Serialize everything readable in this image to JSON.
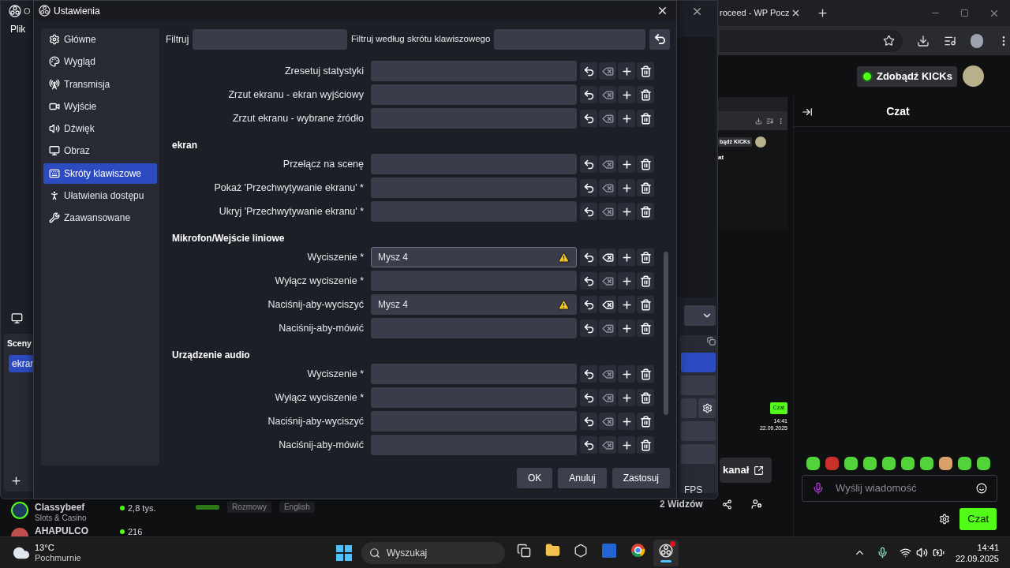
{
  "obs_main": {
    "title": "O",
    "menu": [
      "Plik"
    ],
    "scenes_title": "Sceny",
    "scenes": [
      {
        "label": "ekran",
        "selected": true
      }
    ],
    "status": "FPS"
  },
  "dialog": {
    "title": "Ustawienia",
    "sidebar": [
      {
        "label": "Główne",
        "selected": false
      },
      {
        "label": "Wygląd",
        "selected": false
      },
      {
        "label": "Transmisja",
        "selected": false
      },
      {
        "label": "Wyjście",
        "selected": false
      },
      {
        "label": "Dźwięk",
        "selected": false
      },
      {
        "label": "Obraz",
        "selected": false
      },
      {
        "label": "Skróty klawiszowe",
        "selected": true
      },
      {
        "label": "Ułatwienia dostępu",
        "selected": false
      },
      {
        "label": "Zaawansowane",
        "selected": false
      }
    ],
    "filter_label": "Filtruj",
    "hotkey_filter_label": "Filtruj według skrótu klawiszowego",
    "groups": [
      {
        "rows": [
          {
            "label": "Zresetuj statystyki",
            "warning": false,
            "focused": false
          },
          {
            "label": "Zrzut ekranu - ekran wyjściowy",
            "warning": false,
            "focused": false
          },
          {
            "label": "Zrzut ekranu - wybrane źródło",
            "warning": false,
            "focused": false
          }
        ]
      },
      {
        "title": "ekran",
        "rows": [
          {
            "label": "Przełącz na scenę",
            "warning": false,
            "focused": false
          },
          {
            "label": "Pokaż 'Przechwytywanie ekranu' *",
            "warning": false,
            "focused": false
          },
          {
            "label": "Ukryj 'Przechwytywanie ekranu' *",
            "warning": false,
            "focused": false
          }
        ]
      },
      {
        "title": "Mikrofon/Wejście liniowe",
        "rows": [
          {
            "label": "Wyciszenie *",
            "value": "Mysz 4",
            "warning": true,
            "focused": true
          },
          {
            "label": "Wyłącz wyciszenie *",
            "warning": false,
            "focused": false
          },
          {
            "label": "Naciśnij-aby-wyciszyć",
            "value": "Mysz 4",
            "warning": true,
            "focused": false
          },
          {
            "label": "Naciśnij-aby-mówić",
            "warning": false,
            "focused": false
          }
        ]
      },
      {
        "title": "Urządzenie audio",
        "rows": [
          {
            "label": "Wyciszenie *",
            "warning": false,
            "focused": false
          },
          {
            "label": "Wyłącz wyciszenie *",
            "warning": false,
            "focused": false
          },
          {
            "label": "Naciśnij-aby-wyciszyć",
            "warning": false,
            "focused": false
          },
          {
            "label": "Naciśnij-aby-mówić",
            "warning": false,
            "focused": false
          }
        ]
      }
    ],
    "buttons": [
      "OK",
      "Anuluj",
      "Zastosuj"
    ]
  },
  "browser": {
    "tab_title": "roceed - WP Pocz",
    "kicks_button": "Zdobądź KICKs",
    "chat_title": "Czat",
    "channel_button": "kanał",
    "viewers": "2 Widzów",
    "tags": [
      "Rozmowy",
      "English"
    ],
    "message_placeholder": "Wyślij wiadomość",
    "chat_button": "Czat",
    "streams": [
      {
        "name": "Classybeef",
        "category": "Slots & Casino",
        "viewers": "2,8 tys."
      },
      {
        "name": "AHAPULCO",
        "viewers": "216"
      }
    ],
    "preview": {
      "kicks_button": "bądź KICKs",
      "chat_title": "at",
      "chat_button": "Czat",
      "time": "14:41",
      "date": "22.09.2025"
    }
  },
  "taskbar": {
    "temperature": "13°C",
    "weather": "Pochmurnie",
    "search_label": "Wyszukaj",
    "apps": [
      {
        "selected": false
      },
      {
        "selected": false
      },
      {
        "selected": false
      },
      {
        "selected": false
      },
      {
        "selected": false
      },
      {
        "selected": true
      }
    ],
    "time": "14:41",
    "date": "22.09.2025"
  }
}
